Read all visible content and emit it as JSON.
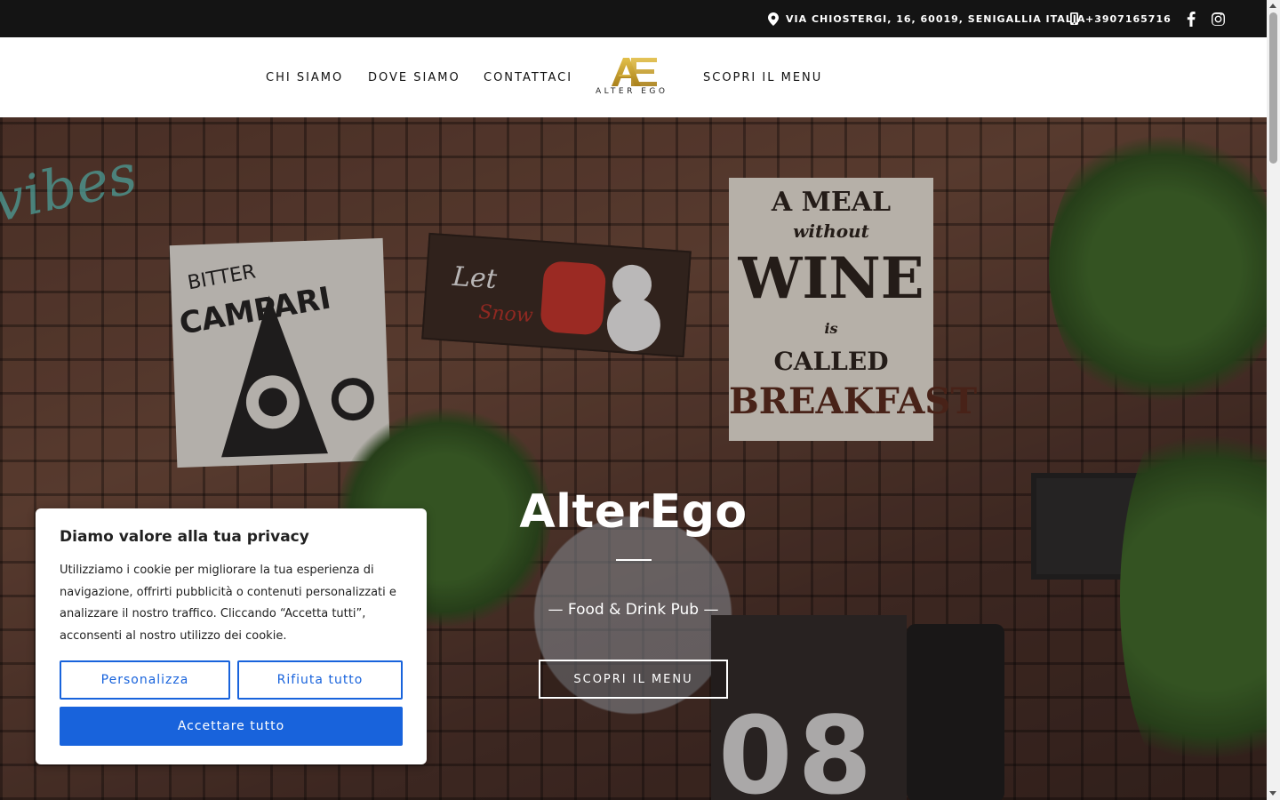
{
  "topbar": {
    "address": "VIA CHIOSTERGI, 16, 60019, SENIGALLIA ITALIA",
    "phone": "+3907165716",
    "icons": [
      "map-pin-icon",
      "mobile-phone-icon",
      "facebook-icon",
      "instagram-icon"
    ]
  },
  "nav": {
    "items": [
      "CHI SIAMO",
      "DOVE SIAMO",
      "CONTATTACI",
      "SCOPRI IL MENU"
    ],
    "logo_text": "ALTER EGO",
    "logo_mark": "AE"
  },
  "hero": {
    "title": "AlterEgo",
    "subtitle": "— Food & Drink Pub —",
    "button": "SCOPRI IL MENU",
    "sign_wine_lines": [
      "A MEAL",
      "without",
      "WINE",
      "is",
      "CALLED",
      "BREAKFAST"
    ],
    "sign_date": "08"
  },
  "cookie": {
    "title": "Diamo valore alla tua privacy",
    "text": "Utilizziamo i cookie per migliorare la tua esperienza di navigazione, offrirti pubblicità o contenuti personalizzati e analizzare il nostro traffico. Cliccando “Accetta tutti”, acconsenti al nostro utilizzo dei cookie.",
    "customize": "Personalizza",
    "reject": "Rifiuta tutto",
    "accept": "Accettare tutto"
  },
  "colors": {
    "accent": "#1863dc",
    "logo_gold": "#c9a227",
    "topbar": "#141414"
  }
}
